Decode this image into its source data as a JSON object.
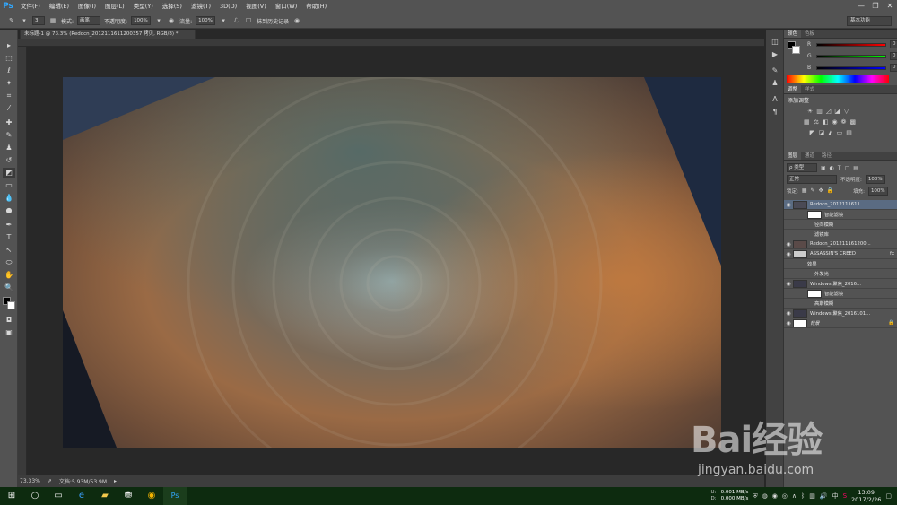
{
  "app": {
    "logo": "Ps"
  },
  "menu": [
    "文件(F)",
    "编辑(E)",
    "图像(I)",
    "图层(L)",
    "类型(Y)",
    "选择(S)",
    "滤镜(T)",
    "3D(D)",
    "视图(V)",
    "窗口(W)",
    "帮助(H)"
  ],
  "window_controls": [
    "—",
    "❐",
    "✕"
  ],
  "options": {
    "brush_size": "3",
    "mode_label": "模式:",
    "mode_value": "画笔",
    "opacity_label": "不透明度:",
    "opacity_value": "100%",
    "flow_label": "流量:",
    "flow_value": "100%",
    "history_label": "抹到历史记录",
    "workspace": "基本功能"
  },
  "document": {
    "tab_title": "未标题-1 @ 73.3% (Redocn_2012111611200357 拷贝, RGB/8) *",
    "zoom": "73.33%",
    "doc_size": "文档:5.93M/53.9M"
  },
  "color_panel": {
    "tabs": [
      "颜色",
      "色板"
    ],
    "r_label": "R",
    "g_label": "G",
    "b_label": "B",
    "r": "0",
    "g": "0",
    "b": "0"
  },
  "adjust_panel": {
    "tabs": [
      "调整",
      "样式"
    ],
    "title": "添加调整"
  },
  "layers_panel": {
    "tabs": [
      "图层",
      "通道",
      "路径"
    ],
    "kind": "ρ 类型",
    "blend": "正常",
    "opacity_label": "不透明度:",
    "opacity_value": "100%",
    "lock_label": "锁定:",
    "fill_label": "填充:",
    "fill_value": "100%",
    "layers": [
      {
        "name": "Redocn_2012111611...",
        "type": "layer",
        "selected": true
      },
      {
        "name": "智能滤镜",
        "type": "sub"
      },
      {
        "name": "径向模糊",
        "type": "sub2"
      },
      {
        "name": "滤镜库",
        "type": "sub2"
      },
      {
        "name": "Redocn_201211161200...",
        "type": "layer"
      },
      {
        "name": "ASSASSIN'S CREED",
        "type": "layer"
      },
      {
        "name": "效果",
        "type": "sub"
      },
      {
        "name": "外发光",
        "type": "sub2"
      },
      {
        "name": "Windows 聚焦_2016...",
        "type": "layer"
      },
      {
        "name": "智能滤镜",
        "type": "sub"
      },
      {
        "name": "高斯模糊",
        "type": "sub2"
      },
      {
        "name": "Windows 聚焦_2016101...",
        "type": "layer"
      },
      {
        "name": "背景",
        "type": "layer"
      }
    ]
  },
  "taskbar": {
    "net_up": "0.001 MB/s",
    "net_down": "0.000 MB/s",
    "up_label": "U:",
    "down_label": "D:",
    "ime": "中",
    "time": "13:09",
    "date": "2017/2/26"
  },
  "watermark": {
    "logo": "Bai经验",
    "url": "jingyan.baidu.com"
  }
}
